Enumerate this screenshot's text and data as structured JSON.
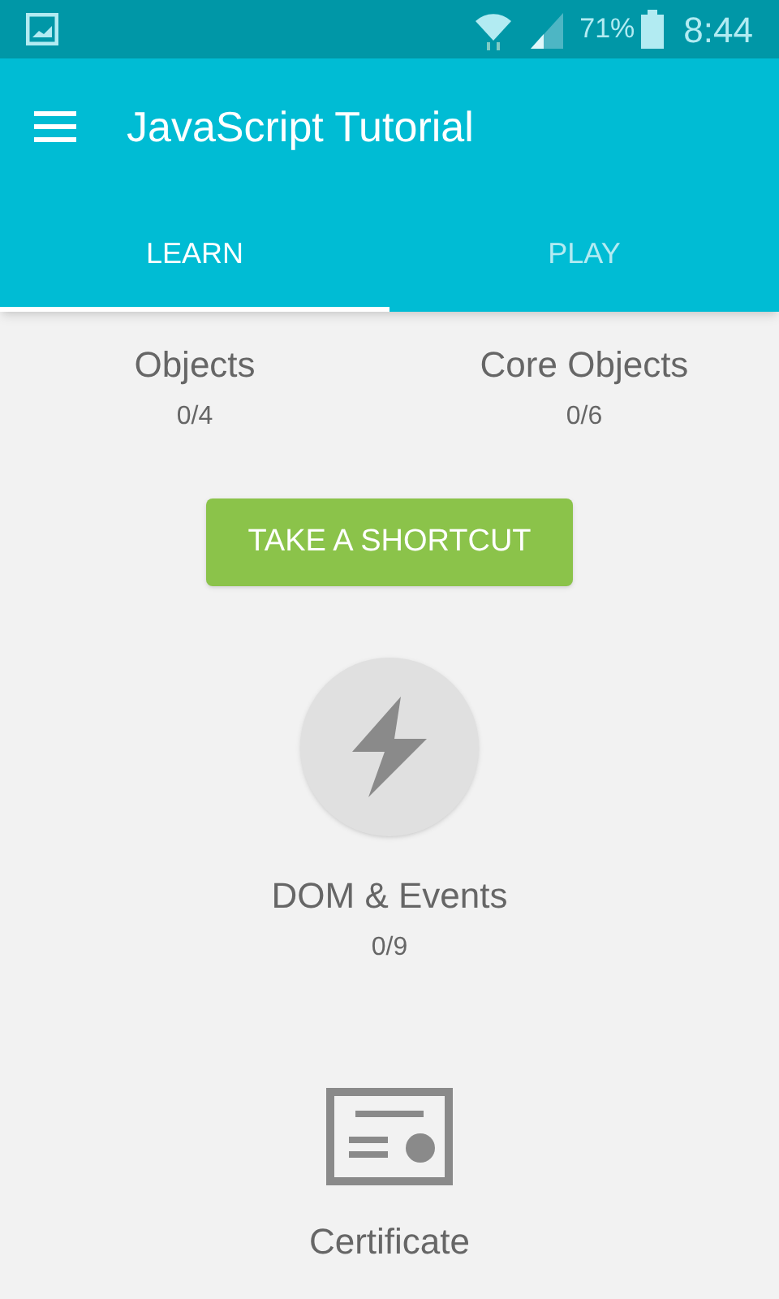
{
  "status_bar": {
    "battery": "71%",
    "time": "8:44"
  },
  "app_bar": {
    "title": "JavaScript Tutorial"
  },
  "tabs": [
    {
      "label": "LEARN",
      "selected": true
    },
    {
      "label": "PLAY",
      "selected": false
    }
  ],
  "lessons": [
    {
      "title": "Objects",
      "progress": "0/4"
    },
    {
      "title": "Core Objects",
      "progress": "0/6"
    }
  ],
  "shortcut_button": "TAKE A SHORTCUT",
  "module": {
    "title": "DOM & Events",
    "progress": "0/9"
  },
  "certificate": {
    "label": "Certificate"
  }
}
